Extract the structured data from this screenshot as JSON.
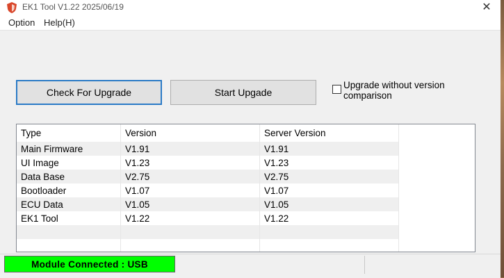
{
  "window": {
    "title": "EK1 Tool V1.22 2025/06/19",
    "close_glyph": "✕",
    "icon": "app-shield-icon"
  },
  "menu": {
    "items": [
      {
        "label": "Option"
      },
      {
        "label": "Help(H)"
      }
    ]
  },
  "actions": {
    "check_label": "Check For Upgrade",
    "start_label": "Start Upgade",
    "checkbox_label": "Upgrade without version comparison",
    "checkbox_checked": false
  },
  "table": {
    "headers": [
      "Type",
      "Version",
      "Server Version"
    ],
    "rows": [
      {
        "type": "Main Firmware",
        "version": "V1.91",
        "server": "V1.91"
      },
      {
        "type": "UI Image",
        "version": "V1.23",
        "server": "V1.23"
      },
      {
        "type": "Data Base",
        "version": "V2.75",
        "server": "V2.75"
      },
      {
        "type": "Bootloader",
        "version": "V1.07",
        "server": "V1.07"
      },
      {
        "type": "ECU Data",
        "version": "V1.05",
        "server": "V1.05"
      },
      {
        "type": "EK1 Tool",
        "version": "V1.22",
        "server": "V1.22"
      }
    ]
  },
  "status": {
    "connection": "Module Connected : USB",
    "color": "#00ff00"
  },
  "colors": {
    "accent_border": "#2a7ac6",
    "button_bg": "#e1e1e1",
    "window_bg": "#f0f0f0"
  }
}
